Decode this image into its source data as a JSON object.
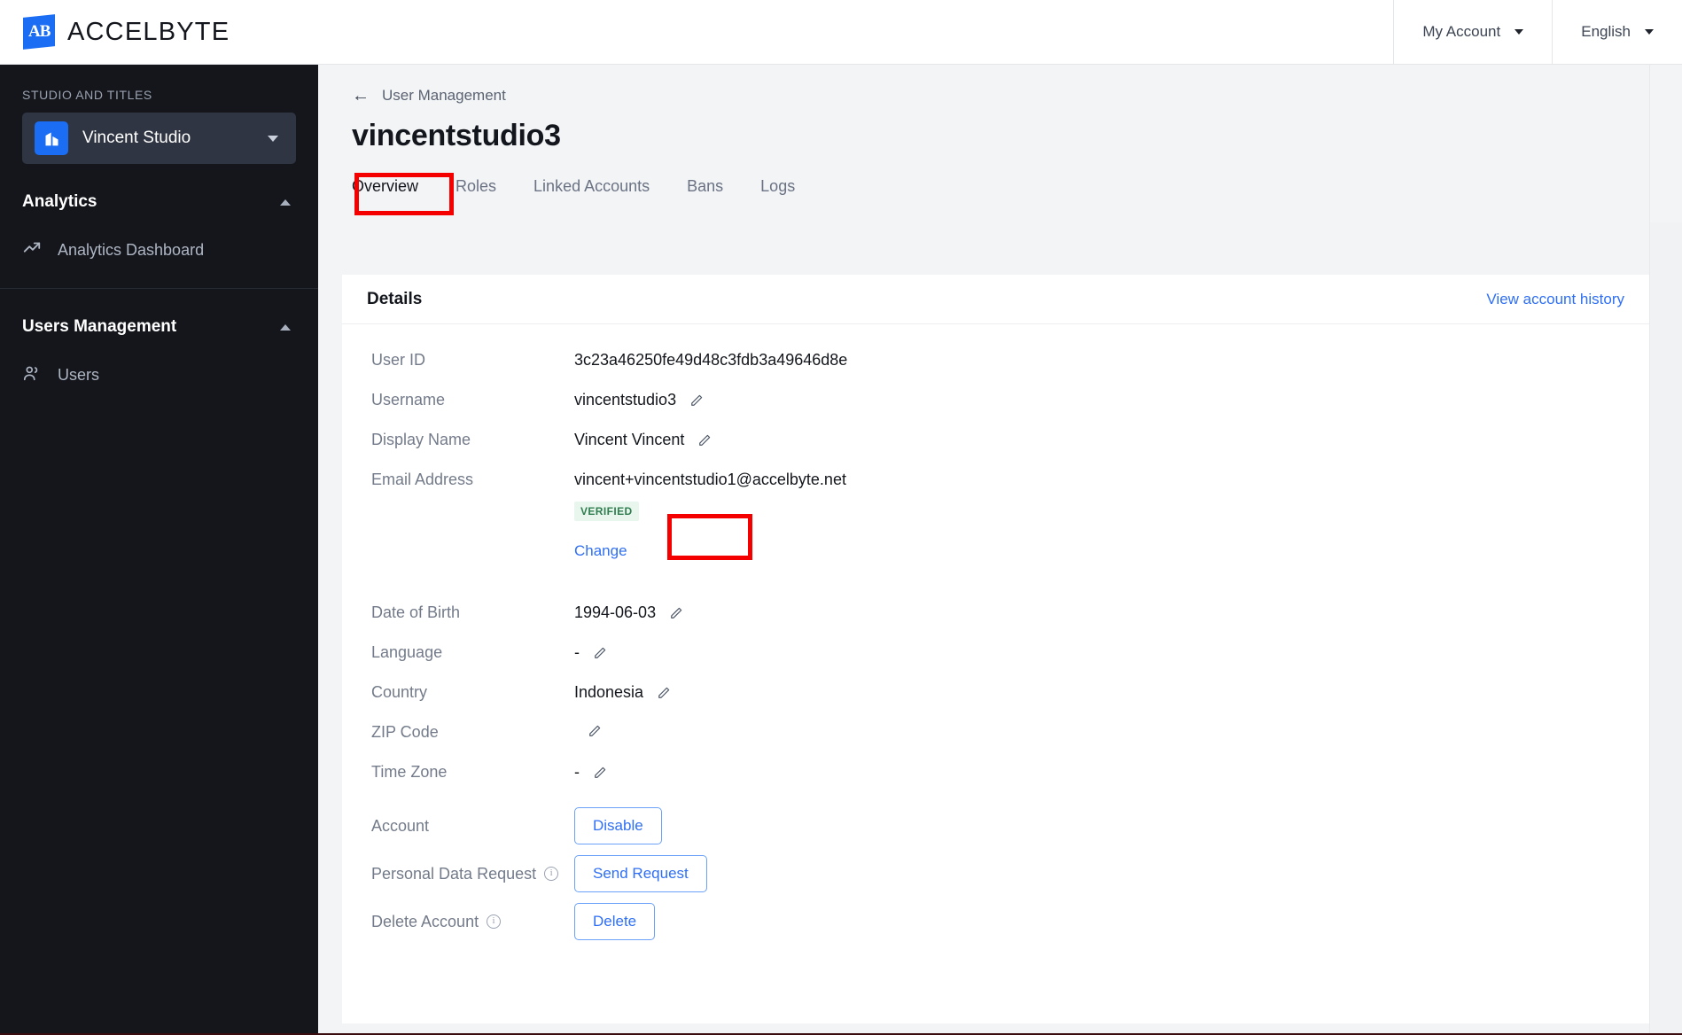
{
  "topbar": {
    "logo_text": "ACCELBYTE",
    "logo_mark": "AB",
    "account_label": "My Account",
    "language_label": "English"
  },
  "sidebar": {
    "studio_label": "STUDIO AND TITLES",
    "studio_name": "Vincent Studio",
    "sections": [
      {
        "title": "Analytics",
        "items": [
          {
            "label": "Analytics Dashboard",
            "icon": "trending-up-icon"
          }
        ]
      },
      {
        "title": "Users Management",
        "items": [
          {
            "label": "Users",
            "icon": "users-icon"
          }
        ]
      }
    ]
  },
  "page": {
    "breadcrumb": "User Management",
    "title": "vincentstudio3",
    "tabs": [
      {
        "label": "Overview",
        "active": true
      },
      {
        "label": "Roles",
        "active": false
      },
      {
        "label": "Linked Accounts",
        "active": false
      },
      {
        "label": "Bans",
        "active": false
      },
      {
        "label": "Logs",
        "active": false
      }
    ]
  },
  "card": {
    "title": "Details",
    "history_link": "View account history",
    "rows": {
      "user_id_label": "User ID",
      "user_id_value": "3c23a46250fe49d48c3fdb3a49646d8e",
      "username_label": "Username",
      "username_value": "vincentstudio3",
      "display_name_label": "Display Name",
      "display_name_value": "Vincent Vincent",
      "email_label": "Email Address",
      "email_value": "vincent+vincentstudio1@accelbyte.net",
      "email_badge": "VERIFIED",
      "email_change_label": "Change",
      "dob_label": "Date of Birth",
      "dob_value": "1994-06-03",
      "language_label": "Language",
      "language_value": "-",
      "country_label": "Country",
      "country_value": "Indonesia",
      "zip_label": "ZIP Code",
      "zip_value": "",
      "timezone_label": "Time Zone",
      "timezone_value": "-",
      "account_label": "Account",
      "account_button": "Disable",
      "pdr_label": "Personal Data Request",
      "pdr_button": "Send Request",
      "delete_label": "Delete Account",
      "delete_button": "Delete"
    }
  },
  "colors": {
    "accent_blue": "#2f6ff5",
    "brand_blue": "#1b6ef3",
    "sidebar_bg": "#14161c",
    "verified_green": "#2f7d4f",
    "annotation_red": "#f40000"
  }
}
